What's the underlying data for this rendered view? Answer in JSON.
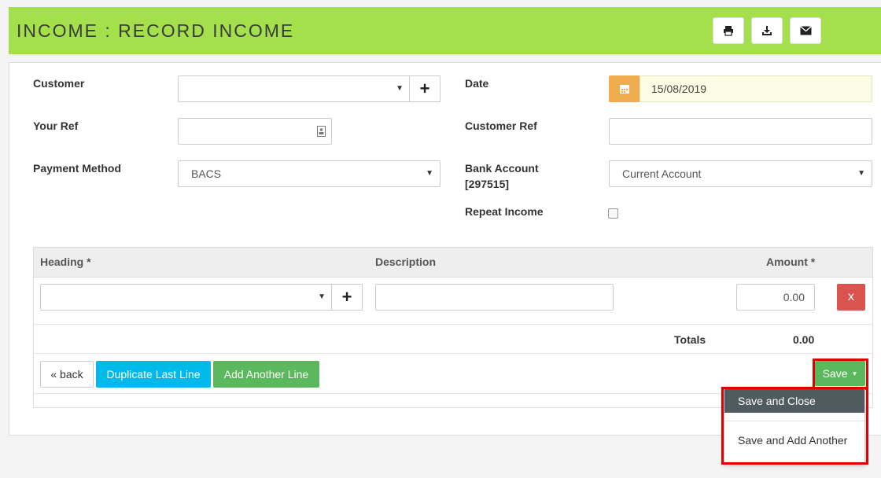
{
  "header": {
    "title": "INCOME : RECORD INCOME",
    "icons": [
      "print-icon",
      "download-icon",
      "envelope-icon"
    ]
  },
  "form": {
    "customer": {
      "label": "Customer",
      "value": ""
    },
    "your_ref": {
      "label": "Your Ref",
      "value": ""
    },
    "payment_method": {
      "label": "Payment Method",
      "value": "BACS"
    },
    "date": {
      "label": "Date",
      "value": "15/08/2019"
    },
    "customer_ref": {
      "label": "Customer Ref",
      "value": ""
    },
    "bank_account": {
      "label_line1": "Bank Account",
      "label_line2": "[297515]",
      "value": "Current Account"
    },
    "repeat_income": {
      "label": "Repeat Income",
      "checked": false
    }
  },
  "table": {
    "columns": {
      "heading": "Heading *",
      "description": "Description",
      "amount": "Amount *"
    },
    "rows": [
      {
        "heading": "",
        "description": "",
        "amount": "0.00",
        "remove_label": "x"
      }
    ],
    "totals_label": "Totals",
    "totals_value": "0.00"
  },
  "actions": {
    "back": "« back",
    "duplicate": "Duplicate Last Line",
    "add_line": "Add Another Line",
    "save": "Save"
  },
  "save_menu": {
    "items": [
      "Save and Close",
      "Save and Add Another"
    ]
  },
  "colors": {
    "header": "#a3e04c",
    "info": "#00b9eb",
    "success": "#5cb85c",
    "danger": "#d9534f",
    "warning": "#f0ad4e",
    "menu_active": "#505b5f",
    "highlight": "#e00000"
  }
}
